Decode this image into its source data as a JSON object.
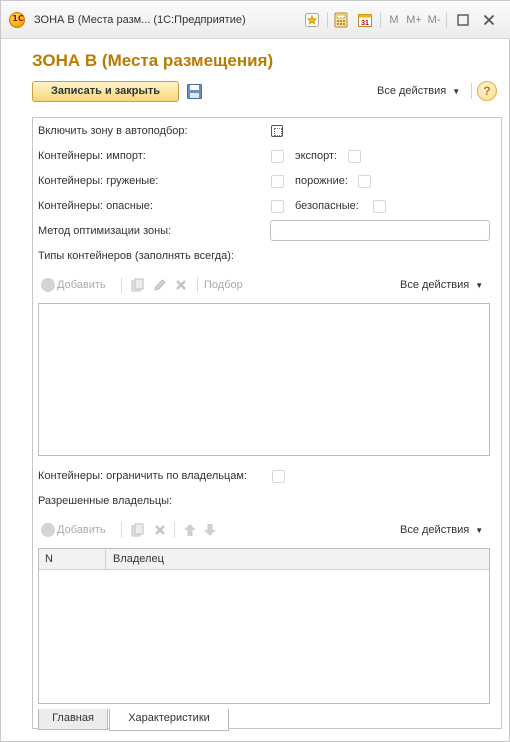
{
  "window": {
    "title": "ЗОНА В (Места разм... (1С:Предприятие)",
    "logo_text": "1С",
    "buttons": [
      "M",
      "M+",
      "M-"
    ]
  },
  "header": {
    "title": "ЗОНА В (Места размещения)",
    "save_close_label": "Записать и закрыть",
    "all_actions_label": "Все действия",
    "help_label": "?"
  },
  "form": {
    "autoselect_label": "Включить зону в автоподбор:",
    "import_label": "Контейнеры: импорт:",
    "export_label": "экспорт:",
    "loaded_label": "Контейнеры: груженые:",
    "empty_label": "порожние:",
    "dangerous_label": "Контейнеры: опасные:",
    "safe_label": "безопасные:",
    "optimization_label": "Метод оптимизации зоны:",
    "optimization_value": "",
    "container_types_label": "Типы контейнеров (заполнять всегда):",
    "restrict_owners_label": "Контейнеры: ограничить по владельцам:",
    "allowed_owners_label": "Разрешенные владельцы:"
  },
  "types_toolbar": {
    "add_label": "Добавить",
    "pick_label": "Подбор",
    "all_actions_label": "Все действия"
  },
  "owners_toolbar": {
    "add_label": "Добавить",
    "all_actions_label": "Все действия"
  },
  "owners_table": {
    "columns": [
      "N",
      "Владелец"
    ],
    "rows": []
  },
  "tabs": [
    {
      "label": "Главная",
      "active": false
    },
    {
      "label": "Характеристики",
      "active": true
    }
  ],
  "colors": {
    "title": "#b97b00",
    "primary_button": "#f6d77c"
  }
}
